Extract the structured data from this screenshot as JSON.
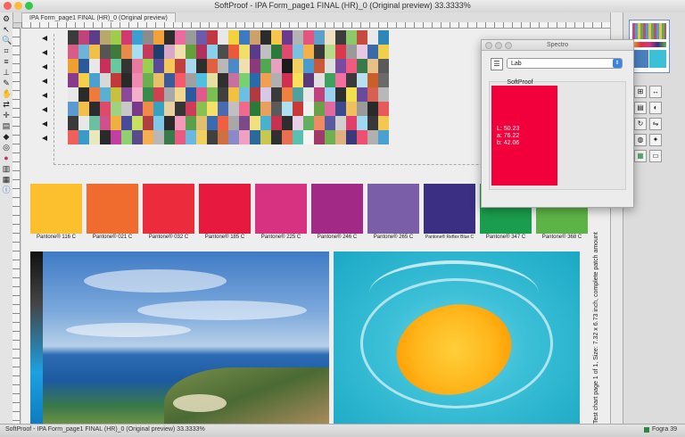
{
  "window": {
    "title": "SoftProof - IPA Form_page1 FINAL (HR)_0 (Original preview) 33.3333%",
    "tab_label": "IPA Form_page1 FINAL (HR)_0 (Original preview)",
    "traffic_lights": {
      "close": "#fc615d",
      "minimize": "#fdbc40",
      "maximize": "#34c84a"
    }
  },
  "toolbox": {
    "tools": [
      "arrow-tool-icon",
      "zoom-tool-icon",
      "crop-tool-icon",
      "list-tool-icon",
      "measure-tool-icon",
      "dropper-tool-icon",
      "hand-tool-icon",
      "transform-tool-icon",
      "page-tool-icon",
      "bucket-tool-icon",
      "target-tool-icon",
      "color-wheel-icon",
      "booklet-icon",
      "chart-icon",
      "info-icon"
    ]
  },
  "patch_colors": [
    [
      "#3b3b3b",
      "#c0437a",
      "#5c3d8a",
      "#b8a96a",
      "#9fcc4e",
      "#d23a6f",
      "#3b9fd0",
      "#8c8c8c",
      "#f2a23a",
      "#2d2d2d",
      "#eb6aa0",
      "#9b9b9b",
      "#6d5aa8",
      "#c23642",
      "#e8e8e8",
      "#f4d23c",
      "#3d7ac0",
      "#cfa16a",
      "#2b2b2b",
      "#f5c64b",
      "#6c3a8c",
      "#b3b3b3",
      "#e45480",
      "#5ea0c8",
      "#efe0c4",
      "#3c3c3c",
      "#8bc86a",
      "#c64a3d",
      "#e9e9e9",
      "#2f86b8"
    ],
    [
      "#d85c86",
      "#6db4d8",
      "#f0c04a",
      "#555555",
      "#3e7a3a",
      "#e88a4a",
      "#a4e0f0",
      "#c43a5a",
      "#1e3f6e",
      "#d8a8c8",
      "#f2dfae",
      "#66a03c",
      "#b03060",
      "#8ad0e8",
      "#4d4d4d",
      "#e85a3a",
      "#f0e06a",
      "#5a3a8a",
      "#c0c0c0",
      "#2a7a3a",
      "#e04a70",
      "#7ac0e0",
      "#f4b04a",
      "#383838",
      "#b8d88a",
      "#d83a4a",
      "#9a9a9a",
      "#e6c8e0",
      "#3a6aa8",
      "#f0d04a"
    ],
    [
      "#f0a030",
      "#2a5a9a",
      "#e8e8e8",
      "#c8305a",
      "#6ac8a0",
      "#343434",
      "#e87aa0",
      "#9ad050",
      "#5a4a9a",
      "#f4c85a",
      "#c04040",
      "#a8d8f0",
      "#2e2e2e",
      "#e06040",
      "#b8b8b8",
      "#4a8ac8",
      "#f0e0b0",
      "#8a3a7a",
      "#50a850",
      "#e8a0c0",
      "#1a1a1a",
      "#f2d060",
      "#4a9ad0",
      "#c85a3a",
      "#dedede",
      "#7a4aa0",
      "#f05a80",
      "#3a7a4a",
      "#e8c08a",
      "#5a5a5a"
    ],
    [
      "#8a3a8a",
      "#f4d04a",
      "#4aa0d0",
      "#d8d8d8",
      "#c03a3a",
      "#2a2a2a",
      "#f08ab0",
      "#6ab050",
      "#e8c06a",
      "#3a5a9a",
      "#f45a6a",
      "#a0a0a0",
      "#50c0e0",
      "#e8e0a0",
      "#303030",
      "#c870a0",
      "#7ad070",
      "#2a6aaa",
      "#f0a050",
      "#b0b0b0",
      "#d03050",
      "#fce05a",
      "#5a3a7a",
      "#e0e0e0",
      "#40a060",
      "#f070a0",
      "#3a3a3a",
      "#b8e0f0",
      "#c8602a",
      "#6a6a6a"
    ],
    [
      "#e8e8e8",
      "#2a2a2a",
      "#f07a3a",
      "#5ab0d0",
      "#c8c040",
      "#8a4a9a",
      "#f4b0c8",
      "#3a8a4a",
      "#d04050",
      "#a8a8a8",
      "#f0d890",
      "#2a5aa0",
      "#e05a8a",
      "#7ac050",
      "#404040",
      "#f4c040",
      "#6ac0e0",
      "#b03a40",
      "#d8c8e8",
      "#3a3a3a",
      "#f08040",
      "#50a0a0",
      "#e8e8e8",
      "#c04080",
      "#9ad0f0",
      "#2e2e2e",
      "#f0e050",
      "#6a4a9a",
      "#d86050",
      "#b8b8b8"
    ],
    [
      "#5a9ad0",
      "#f2c04a",
      "#2c2c2c",
      "#e04a6a",
      "#a0d080",
      "#c8c8c8",
      "#7a3a8a",
      "#f08a4a",
      "#3aa0c0",
      "#e8d0a0",
      "#363636",
      "#d03a5a",
      "#8ac050",
      "#f4e06a",
      "#4a6ab0",
      "#c0c0c0",
      "#f06a90",
      "#2a7a3a",
      "#e8a060",
      "#5a5a5a",
      "#b0e0f0",
      "#c83a3a",
      "#f0f0f0",
      "#6aa04a",
      "#e06aa0",
      "#3a4a8a",
      "#f0c060",
      "#9a9a9a",
      "#2a2a2a",
      "#e85a5a"
    ],
    [
      "#3a3a3a",
      "#e8e8e8",
      "#6ac0a0",
      "#d0508a",
      "#f0b040",
      "#4a4a9a",
      "#c8e060",
      "#b04040",
      "#80c8e8",
      "#2a2a2a",
      "#f49ab8",
      "#5aa04a",
      "#e0c070",
      "#3a6ab0",
      "#f06040",
      "#a8a8a8",
      "#7a4a8a",
      "#f0e080",
      "#4ab0d0",
      "#c83050",
      "#2e2e2e",
      "#e8d0e8",
      "#60b060",
      "#f08a60",
      "#5a5aa0",
      "#d0d0d0",
      "#e0406a",
      "#a0d8f0",
      "#383838",
      "#f4c850"
    ],
    [
      "#f0605a",
      "#3a9ac8",
      "#e8e8c0",
      "#2a2a2a",
      "#c040a0",
      "#90d070",
      "#5a4a8a",
      "#f4b050",
      "#b8b8b8",
      "#3a7a4a",
      "#e85a80",
      "#6ab8e0",
      "#f0d060",
      "#404040",
      "#d07040",
      "#8a8ac8",
      "#f0a0c0",
      "#2a6a9a",
      "#c8c850",
      "#303030",
      "#e87050",
      "#5ac0b0",
      "#f4f4f4",
      "#a03a6a",
      "#70b050",
      "#e0b080",
      "#3a3a7a",
      "#f05070",
      "#b0b0b0",
      "#4aa0d0"
    ]
  ],
  "pantone": [
    {
      "label": "Pantone® 116 C",
      "color": "#fcbf2d"
    },
    {
      "label": "Pantone® 021 C",
      "color": "#f06b2e"
    },
    {
      "label": "Pantone® 032 C",
      "color": "#ec2c3d"
    },
    {
      "label": "Pantone® 185 C",
      "color": "#e8193f"
    },
    {
      "label": "Pantone® 225 C",
      "color": "#d73282"
    },
    {
      "label": "Pantone® 246 C",
      "color": "#a22a86"
    },
    {
      "label": "Pantone® 265 C",
      "color": "#7b5ea8"
    },
    {
      "label": "Pantone® Reflex Blue C",
      "color": "#3a2f82"
    },
    {
      "label": "Pantone® 347 C",
      "color": "#1a9d4c"
    },
    {
      "label": "Pantone® 368 C",
      "color": "#5db446"
    }
  ],
  "test_chart_text": "Test chart page 1 of 1, Size: 7.32 x 6.73 inch, complete patch amount",
  "spectro": {
    "title": "Spectro",
    "mode": "Lab",
    "group_label": "SoftProof",
    "swatch_color": "#f2003c",
    "L": "L: 50.23",
    "a": "a: 76.22",
    "b": "b: 42.06"
  },
  "status": {
    "left": "SoftProof - IPA Form_page1 FINAL (HR)_0 (Original preview) 33.3333%",
    "right": "Fogra 39",
    "right_color": "#2a8a3a"
  }
}
